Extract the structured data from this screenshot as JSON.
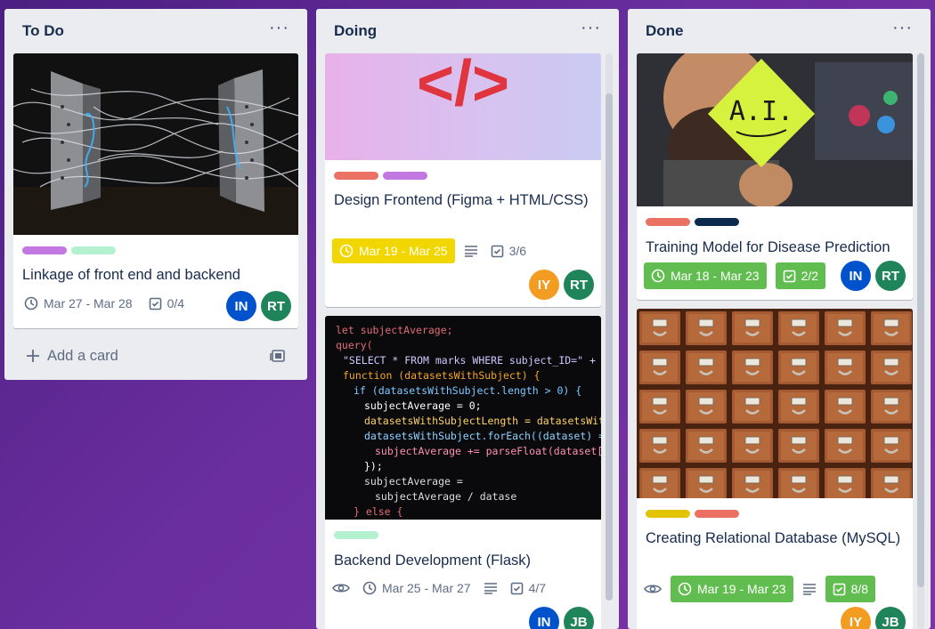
{
  "lists": [
    {
      "title": "To Do",
      "menu": "···",
      "cards": [
        {
          "title": "Linkage of front end and backend",
          "due": "Mar 27 - Mar 28",
          "checklist": "0/4",
          "members": [
            "IN",
            "RT"
          ]
        }
      ],
      "add_card": "Add a card"
    },
    {
      "title": "Doing",
      "menu": "···",
      "cards": [
        {
          "title": "Design Frontend (Figma + HTML/CSS)",
          "due": "Mar 19 - Mar 25",
          "checklist": "3/6",
          "members": [
            "IY",
            "RT"
          ],
          "cover_text": "</>"
        },
        {
          "title": "Backend Development (Flask)",
          "due": "Mar 25 - Mar 27",
          "checklist": "4/7",
          "members": [
            "IN",
            "JB"
          ],
          "code_lines": [
            "let subjectAverage;",
            "query(",
            "\"SELECT * FROM marks WHERE subject_ID=\" + subject",
            "function (datasetsWithSubject) {",
            "if (datasetsWithSubject.length > 0) {",
            "subjectAverage = 0;",
            "datasetsWithSubjectLength = datasetsWithSu",
            "datasetsWithSubject.forEach((dataset) => {",
            "subjectAverage += parseFloat(dataset[\"",
            "});",
            "subjectAverage =",
            "subjectAverage / datase",
            "} else {"
          ]
        }
      ]
    },
    {
      "title": "Done",
      "menu": "···",
      "cards": [
        {
          "title": "Training Model for Disease Prediction",
          "due": "Mar 18 - Mar 23",
          "checklist": "2/2",
          "members": [
            "IN",
            "RT"
          ],
          "sign_text": "A.I."
        },
        {
          "title": "Creating Relational Database (MySQL)",
          "due": "Mar 19 - Mar 23",
          "checklist": "8/8",
          "members": [
            "IY",
            "JB"
          ]
        }
      ]
    }
  ],
  "colors": {
    "label_purple": "#c377e0",
    "label_mint": "#b3f1d0",
    "label_red": "#eb7165",
    "label_yellow": "#e2c400",
    "label_navy": "#0c2a4d",
    "avatar_in": "#0052cc",
    "avatar_rt": "#1f845a",
    "avatar_iy": "#f29c22",
    "avatar_jb": "#1f845a"
  }
}
